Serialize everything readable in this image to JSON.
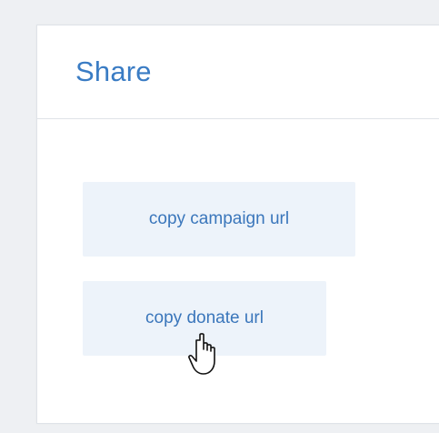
{
  "share_panel": {
    "title": "Share",
    "buttons": {
      "copy_campaign_label": "copy campaign url",
      "copy_donate_label": "copy donate url"
    }
  },
  "cursor": {
    "icon": "hand-pointer-icon"
  },
  "colors": {
    "accent": "#3a7cc4",
    "button_bg": "#edf3fa",
    "page_bg": "#eef0f3"
  }
}
